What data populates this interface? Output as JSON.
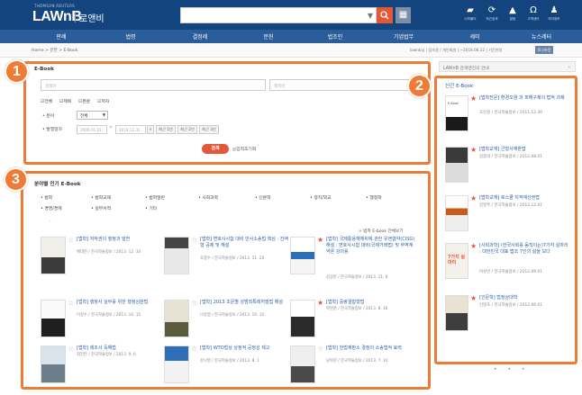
{
  "header": {
    "brand_small": "THOMSON REUTERS",
    "brand": "LAWnB",
    "sub": "로앤비",
    "search_icon": "search-icon",
    "menu_icon": "grid-icon",
    "utility": [
      {
        "icon": "folder-icon",
        "label": "나의폴더"
      },
      {
        "icon": "history-icon",
        "label": "최근검색"
      },
      {
        "icon": "bell-icon",
        "label": "알림"
      },
      {
        "icon": "headset-icon",
        "label": "고객센터"
      },
      {
        "icon": "user-icon",
        "label": "마이정보"
      }
    ]
  },
  "nav": [
    "판례",
    "법령",
    "결정례",
    "문헌",
    "법조인",
    "기업법무",
    "세미",
    "뉴스레터"
  ],
  "breadcrumb": {
    "left": "Home > 문헌 > E-Book",
    "right": "lawnb님 | 접속중 / 개인회원 | ~2018.06.22 | 기간연장",
    "tag": "로그아웃"
  },
  "search_panel": {
    "badge": "1",
    "title": "E-Book",
    "keyword_placeholder": "검색어",
    "option_placeholder": "제목어",
    "checks": [
      "전체",
      "제목",
      "본문",
      "저자"
    ],
    "field_label": "분야",
    "field_value": "전체",
    "date_label": "발행일자",
    "date_from": "2006.01.01",
    "date_to": "2018.12.31",
    "date_buttons": [
      "최근 1년",
      "최근 2년",
      "최근 3년"
    ],
    "search_btn": "검색",
    "reset": "입력초기화"
  },
  "right_panel": {
    "badge": "2",
    "head": "LAWnB 검색엔진의 안내",
    "title": "신간 E-Book",
    "items": [
      {
        "title": "[법학전문] 환경오염 과 피해구제의 법적 과제",
        "meta": "조인성 / 한국학술정보 / 2011.12.30",
        "cover_label": "E-Book"
      },
      {
        "title": "[법학교재] 군형사재판법",
        "meta": "김종대 / 한국학술정보 / 2012.08.01"
      },
      {
        "title": "[법학교재] 로스쿨 지적재산권법",
        "meta": "김영주 / 한국학술정보 / 2012.12.01"
      },
      {
        "title": "[사회과학] (한국사회를 움직이는)7가지 실마리 : 대한민국 대표 법조 7인의 삶을 보다",
        "meta": "이성민 / 한국학술정보 / 2012.09.01",
        "cover_label": "7가지 실마리"
      },
      {
        "title": "[인문학] 법정상대학",
        "meta": "신명호 / 한국학술정보 / 2012.06.01"
      }
    ],
    "dots": "• • •"
  },
  "popular_panel": {
    "badge": "3",
    "title": "분야별 인기 E-Book",
    "categories": [
      [
        "법학",
        "법학교재",
        "법학일반",
        "사회과학",
        "인문학",
        "정치/외교",
        "행정학"
      ],
      [
        "경영/경제",
        "실무서적",
        "기타"
      ]
    ],
    "more_arrow": "⌄",
    "more": "+ 법학 E-book 전체보기",
    "books": [
      {
        "title": "[법학] 저작권의 행정과 발전",
        "meta": "배대헌 / 한국학술정보 / 2013. 12. 30"
      },
      {
        "title": "[법학] 변호사시험 대비 민사소송법 핵심 : 진액형 공제 및 해설",
        "meta": "조창수 / 한국학술정보 / 2013. 11. 20"
      },
      {
        "title": "[법학] 국제통용해체위에 관한 유엔협약(CISG) 해설 : 변호사시험 대비(국제거래법) 및 무역계약론 강의용",
        "meta": "김상만 / 한국학술정보 / 2013. 11. 8"
      },
      {
        "title": "[법학] 행정사 실무를 위한 행정심판법",
        "meta": "이정수 / 한국학술정보 / 2013. 10. 15"
      },
      {
        "title": "[법학] 2013 조문별 성범죄특례처벌법 해설",
        "meta": "나승엽 / 한국학술정보 / 2013. 10. 10"
      },
      {
        "title": "[법학] 중량결합형법",
        "meta": "박현준 / 한국학술정보 / 2013. 8. 16"
      },
      {
        "title": "[법학] 제조사 독해법",
        "meta": "최진만 / 한국학술정보 / 2013. 9. 6"
      },
      {
        "title": "[법학] WTO법상 상정적 공정성 제고",
        "meta": "강나영 / 한국학술정보 / 2013. 8. 1"
      },
      {
        "title": "[법학] 헌법재판소 결정의 소송법적 효력",
        "meta": "남복현 / 한국학술정보 / 2013. 7. 10"
      }
    ]
  },
  "colors": {
    "accent": "#f07b35",
    "header": "#14447d",
    "nav": "#2b5d9b",
    "search": "#e4583a",
    "link": "#2a5ea6"
  }
}
